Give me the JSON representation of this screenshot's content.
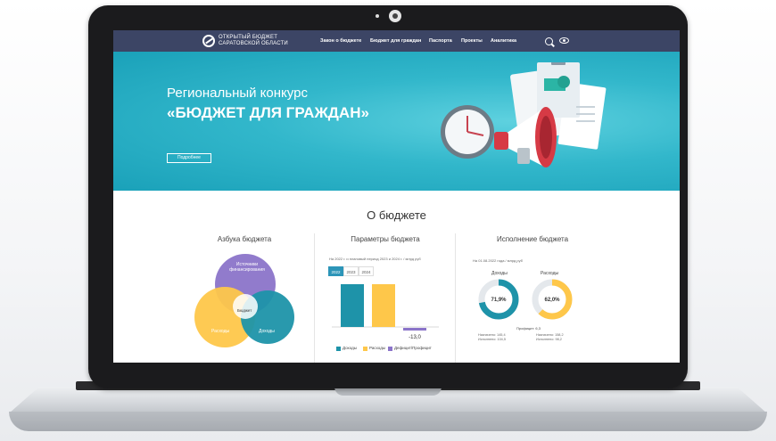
{
  "header": {
    "logo_line1": "ОТКРЫТЫЙ БЮДЖЕТ",
    "logo_line2": "САРАТОВСКОЙ ОБЛАСТИ",
    "nav": [
      "Закон о бюджете",
      "Бюджет для граждан",
      "Паспорта",
      "Проекты",
      "Аналитика"
    ]
  },
  "hero": {
    "title_line1": "Региональный конкурс",
    "title_line2": "«БЮДЖЕТ ДЛЯ ГРАЖДАН»",
    "button_label": "Подробнее",
    "slider_dots": 9
  },
  "about": {
    "title": "О бюджете",
    "col1": {
      "title": "Азбука бюджета",
      "circles": [
        "Источники финансирования",
        "Бюджет",
        "Расходы",
        "Доходы"
      ]
    },
    "col2": {
      "title": "Параметры бюджета",
      "note": "На 2022 г. и плановый период 2023 и 2024 г. / млрд руб",
      "tabs": [
        "2022",
        "2023",
        "2024"
      ],
      "active_tab": "2022",
      "legend": [
        "Доходы",
        "Расходы",
        "Дефицит/Профицит"
      ]
    },
    "col3": {
      "title": "Исполнение бюджета",
      "note": "На 01.08.2022 года / млрд руб",
      "income_label": "Доходы",
      "expense_label": "Расходы",
      "profit_label": "Профицит: 6,3",
      "income_plan": "Назначено: 145,4",
      "income_done": "Исполнено: 104,5",
      "expense_plan": "Назначено: 158,2",
      "expense_done": "Исполнено: 98,2"
    }
  },
  "chart_data": [
    {
      "type": "bar",
      "categories": [
        "Доходы",
        "Расходы",
        "Дефицит/Профицит"
      ],
      "values": [
        145.3,
        158.2,
        -13.0
      ],
      "value_labels": [
        "145,3",
        "158,2",
        "-13,0"
      ],
      "colors": [
        "#1e93a9",
        "#fec74a",
        "#8b74c9"
      ],
      "ylim": [
        -20,
        170
      ]
    },
    {
      "type": "pie",
      "categories": [
        "Доходы",
        "Расходы"
      ],
      "values": [
        71.9,
        62.0
      ],
      "value_labels": [
        "71,9%",
        "62,0%"
      ],
      "colors": [
        "#1e93a9",
        "#fec74a"
      ]
    }
  ],
  "colors": {
    "nav_bg": "#3c4565",
    "hero": "#32b7cb",
    "accent": "#2c95b8"
  }
}
